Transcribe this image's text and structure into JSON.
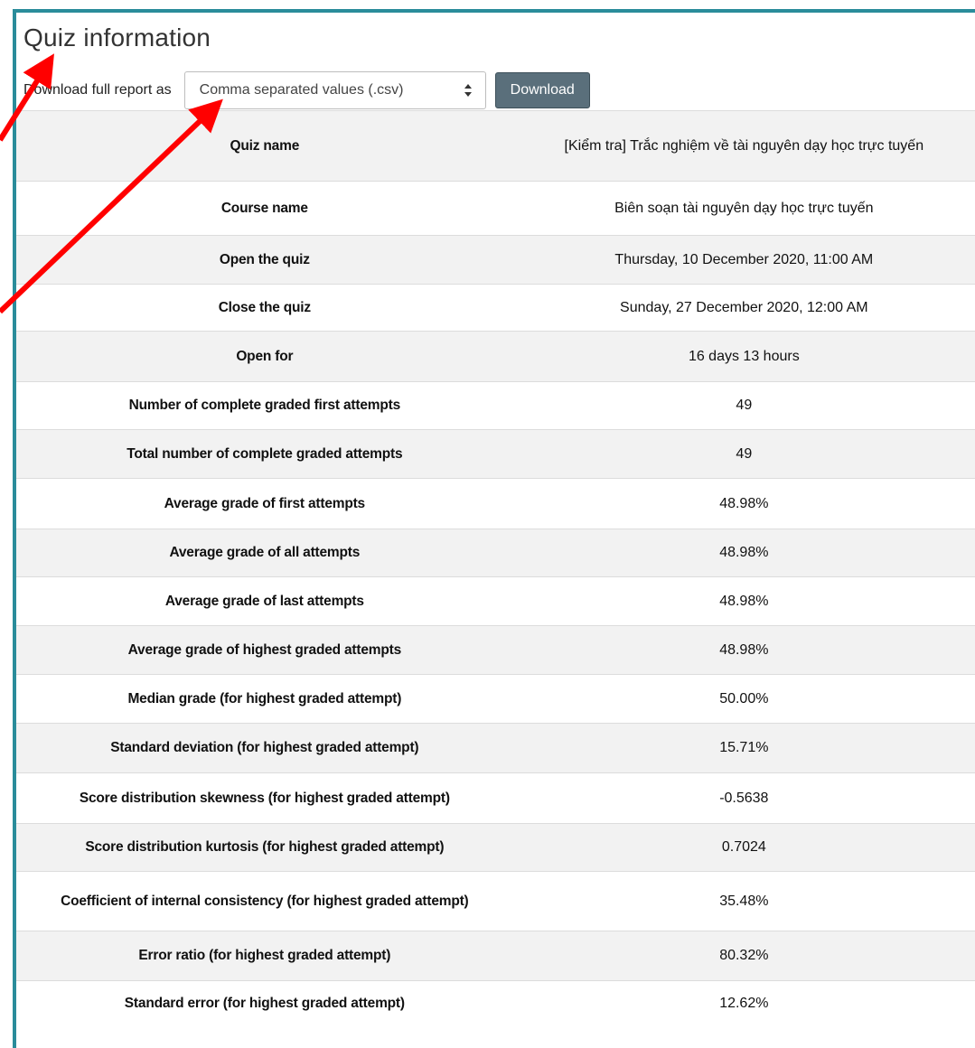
{
  "page": {
    "title": "Quiz information"
  },
  "download": {
    "label": "Download full report as",
    "selected_format": "Comma separated values (.csv)",
    "button_label": "Download"
  },
  "rows": [
    {
      "key": "Quiz name",
      "value": "[Kiểm tra] Trắc nghiệm về tài nguyên dạy học trực tuyến"
    },
    {
      "key": "Course name",
      "value": "Biên soạn tài nguyên dạy học trực tuyến"
    },
    {
      "key": "Open the quiz",
      "value": "Thursday, 10 December 2020, 11:00 AM"
    },
    {
      "key": "Close the quiz",
      "value": "Sunday, 27 December 2020, 12:00 AM"
    },
    {
      "key": "Open for",
      "value": "16 days 13 hours"
    },
    {
      "key": "Number of complete graded first attempts",
      "value": "49"
    },
    {
      "key": "Total number of complete graded attempts",
      "value": "49"
    },
    {
      "key": "Average grade of first attempts",
      "value": "48.98%"
    },
    {
      "key": "Average grade of all attempts",
      "value": "48.98%"
    },
    {
      "key": "Average grade of last attempts",
      "value": "48.98%"
    },
    {
      "key": "Average grade of highest graded attempts",
      "value": "48.98%"
    },
    {
      "key": "Median grade (for highest graded attempt)",
      "value": "50.00%"
    },
    {
      "key": "Standard deviation (for highest graded attempt)",
      "value": "15.71%"
    },
    {
      "key": "Score distribution skewness (for highest graded attempt)",
      "value": "-0.5638"
    },
    {
      "key": "Score distribution kurtosis (for highest graded attempt)",
      "value": "0.7024"
    },
    {
      "key": "Coefficient of internal consistency (for highest graded attempt)",
      "value": "35.48%"
    },
    {
      "key": "Error ratio (for highest graded attempt)",
      "value": "80.32%"
    },
    {
      "key": "Standard error (for highest graded attempt)",
      "value": "12.62%"
    }
  ],
  "colors": {
    "frame_border": "#2a8c9a",
    "stripe": "#f2f2f2",
    "button_bg": "#5a6f7b",
    "annotation_arrow": "#ff0000"
  }
}
